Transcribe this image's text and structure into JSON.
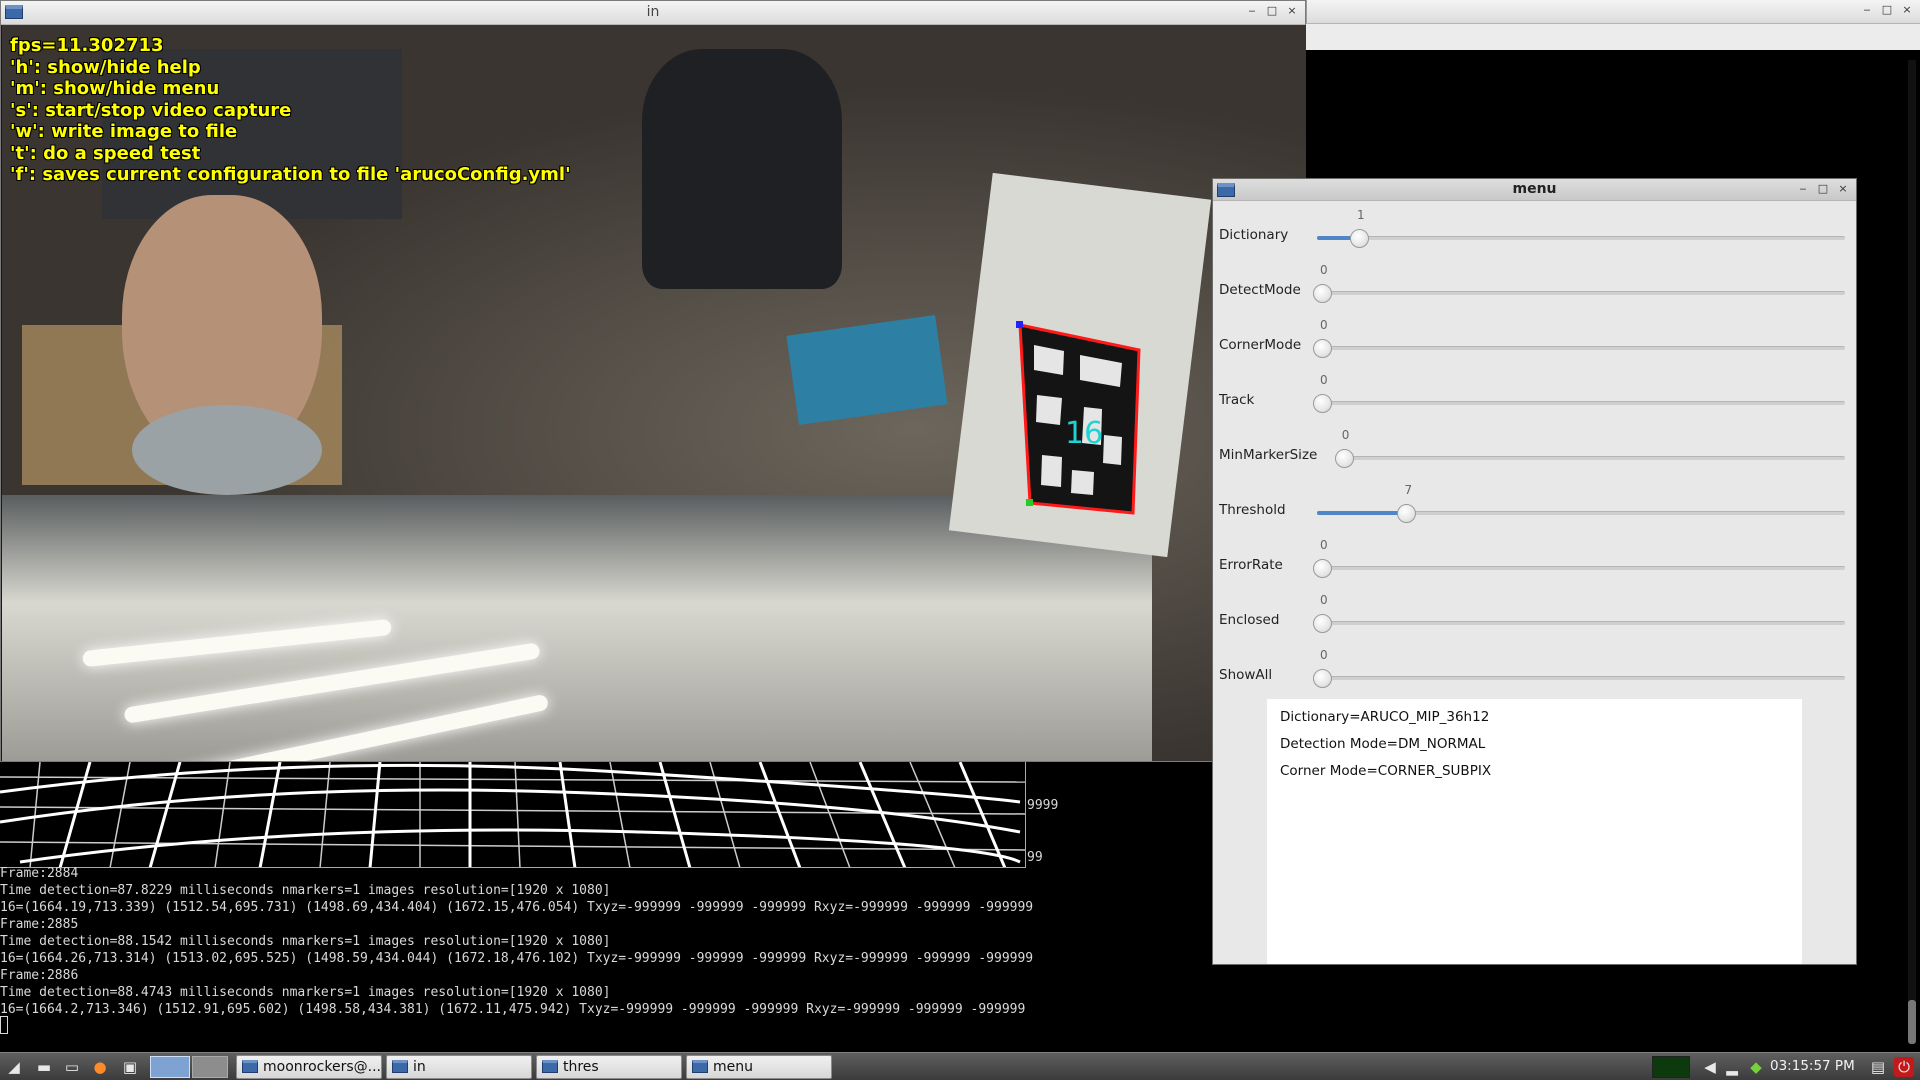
{
  "windows": {
    "in": {
      "title": "in"
    },
    "right": {
      "title": ""
    },
    "menu": {
      "title": "menu"
    }
  },
  "window_buttons": {
    "minimize": "‒",
    "maximize": "□",
    "close": "×"
  },
  "overlay": {
    "lines": [
      "fps=11.302713",
      "'h': show/hide help",
      "'m': show/hide menu",
      "'s': start/stop video capture",
      "'w': write image to file",
      "'t': do a speed test",
      "'f': saves current configuration to file 'arucoConfig.yml'"
    ],
    "marker_id": "16",
    "text_color": "#ffff00",
    "marker_border_color": "#ff1a1a",
    "marker_id_color": "#1fd3d3"
  },
  "trackbars": [
    {
      "label": "Dictionary",
      "value": "1",
      "fraction": 0.07,
      "filled": true
    },
    {
      "label": "DetectMode",
      "value": "0",
      "fraction": 0.0,
      "filled": false
    },
    {
      "label": "CornerMode",
      "value": "0",
      "fraction": 0.0,
      "filled": false
    },
    {
      "label": "Track",
      "value": "0",
      "fraction": 0.0,
      "filled": false
    },
    {
      "label": "MinMarkerSize",
      "value": "0",
      "fraction": 0.0,
      "filled": false
    },
    {
      "label": "Threshold",
      "value": "7",
      "fraction": 0.16,
      "filled": true
    },
    {
      "label": "ErrorRate",
      "value": "0",
      "fraction": 0.0,
      "filled": false
    },
    {
      "label": "Enclosed",
      "value": "0",
      "fraction": 0.0,
      "filled": false
    },
    {
      "label": "ShowAll",
      "value": "0",
      "fraction": 0.0,
      "filled": false
    }
  ],
  "info": {
    "dictionary": "Dictionary=ARUCO_MIP_36h12",
    "detection_mode": "Detection Mode=DM_NORMAL",
    "corner_mode": "Corner Mode=CORNER_SUBPIX"
  },
  "terminal": {
    "partial_1": "9999",
    "partial_2": "99",
    "lines": [
      "Frame:2884",
      "Time detection=87.8229 milliseconds nmarkers=1 images resolution=[1920 x 1080]",
      "16=(1664.19,713.339) (1512.54,695.731) (1498.69,434.404) (1672.15,476.054) Txyz=-999999 -999999 -999999 Rxyz=-999999 -999999 -999999",
      "Frame:2885",
      "Time detection=88.1542 milliseconds nmarkers=1 images resolution=[1920 x 1080]",
      "16=(1664.26,713.314) (1513.02,695.525) (1498.59,434.044) (1672.18,476.102) Txyz=-999999 -999999 -999999 Rxyz=-999999 -999999 -999999",
      "Frame:2886",
      "Time detection=88.4743 milliseconds nmarkers=1 images resolution=[1920 x 1080]",
      "16=(1664.2,713.346) (1512.91,695.602) (1498.58,434.381) (1672.11,475.942) Txyz=-999999 -999999 -999999 Rxyz=-999999 -999999 -999999"
    ]
  },
  "taskbar": {
    "launchers": [
      "menu-icon",
      "file-manager-icon",
      "terminal-icon",
      "firefox-icon",
      "show-desktop-icon"
    ],
    "tasks": [
      {
        "label": "moonrockers@...",
        "icon": "terminal-icon"
      },
      {
        "label": "in",
        "icon": "window-icon"
      },
      {
        "label": "thres",
        "icon": "window-icon"
      },
      {
        "label": "menu",
        "icon": "window-icon"
      }
    ],
    "clock": "03:15:57 PM"
  }
}
